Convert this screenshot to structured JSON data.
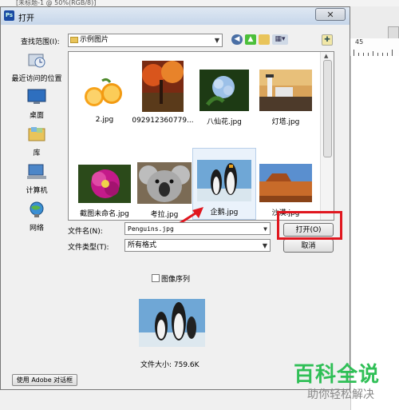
{
  "app_strip": "[未标题-1 @ 50%(RGB/8)]",
  "ruler_number": "45",
  "dialog": {
    "title": "打开",
    "close_symbol": "✕",
    "lookin_label": "查找范围(I):",
    "lookin_value": "示例图片",
    "places": [
      {
        "label": "最近访问的位置",
        "icon": "recent-places-icon"
      },
      {
        "label": "桌面",
        "icon": "desktop-icon"
      },
      {
        "label": "库",
        "icon": "libraries-icon"
      },
      {
        "label": "计算机",
        "icon": "computer-icon"
      },
      {
        "label": "网络",
        "icon": "network-icon"
      }
    ],
    "files": [
      {
        "name": "2.jpg"
      },
      {
        "name": "092912360779..."
      },
      {
        "name": "八仙花.jpg"
      },
      {
        "name": "灯塔.jpg"
      },
      {
        "name": "截图未命名.jpg"
      },
      {
        "name": "考拉.jpg"
      },
      {
        "name": "企鹅.jpg",
        "selected": true
      },
      {
        "name": "沙漠.jpg"
      }
    ],
    "filename_label": "文件名(N):",
    "filename_value": "Penguins.jpg",
    "filetype_label": "文件类型(T):",
    "filetype_value": "所有格式",
    "open_button": "打开(O)",
    "cancel_button": "取消",
    "image_sequence_label": "图像序列",
    "file_size": "文件大小: 759.6K",
    "adobe_dialog_button": "使用 Adobe 对话框"
  },
  "watermark": {
    "main": "百科全说",
    "sub": "助你轻松解决"
  },
  "colors": {
    "highlight_red": "#e0171f",
    "watermark_green": "#2fbf56"
  }
}
